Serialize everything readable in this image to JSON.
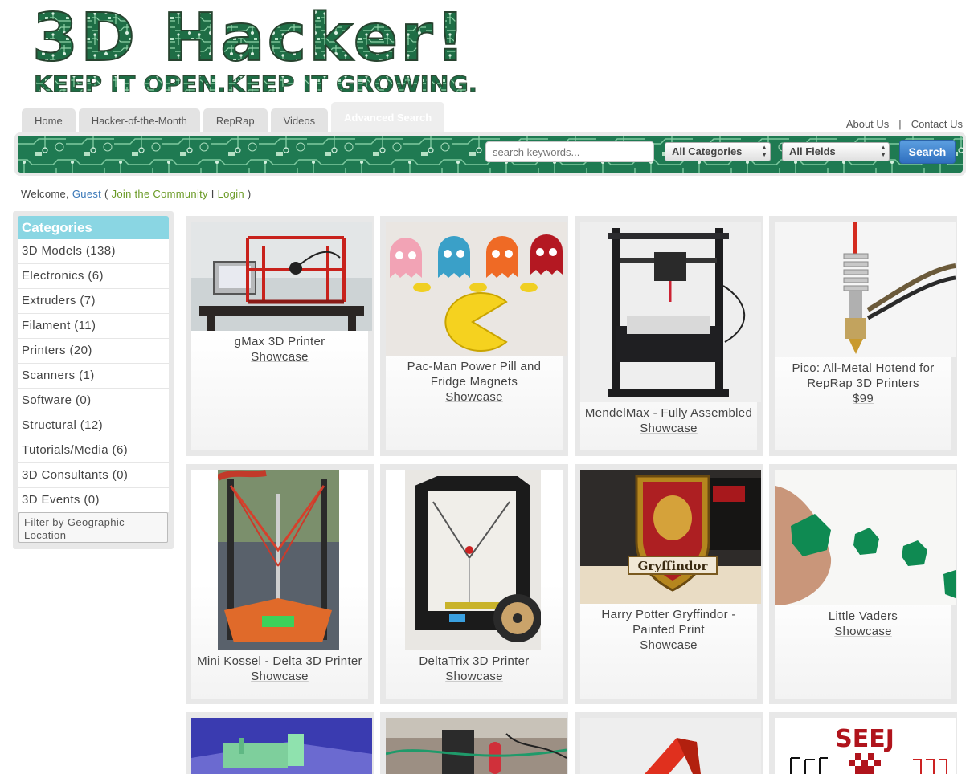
{
  "logo": {
    "title": "3D Hacker!",
    "tagline": "KEEP IT OPEN.KEEP IT GROWING."
  },
  "nav": {
    "tabs": [
      "Home",
      "Hacker-of-the-Month",
      "RepRap",
      "Videos",
      "Advanced Search"
    ],
    "active_tab": "Advanced Search",
    "about": "About Us",
    "separator": "|",
    "contact": "Contact Us"
  },
  "search": {
    "placeholder": "search keywords...",
    "category": "All Categories",
    "field": "All Fields",
    "button": "Search"
  },
  "welcome": {
    "prefix": "Welcome,",
    "user": "Guest",
    "open": "(",
    "join": "Join the Community",
    "sep": "I",
    "login": "Login",
    "close": ")"
  },
  "sidebar": {
    "title": "Categories",
    "items": [
      "3D Models (138)",
      "Electronics (6)",
      "Extruders (7)",
      "Filament (11)",
      "Printers (20)",
      "Scanners (1)",
      "Software (0)",
      "Structural (12)",
      "Tutorials/Media (6)",
      "3D Consultants (0)",
      "3D Events (0)"
    ],
    "geo_filter": "Filter by Geographic Location"
  },
  "listings": [
    {
      "title": "gMax 3D Printer",
      "sub": "Showcase"
    },
    {
      "title": "Pac-Man Power Pill and Fridge Magnets",
      "sub": "Showcase"
    },
    {
      "title": "MendelMax - Fully Assembled",
      "sub": "Showcase"
    },
    {
      "title": "Pico: All-Metal Hotend for RepRap 3D Printers",
      "sub": "$99"
    },
    {
      "title": "Mini Kossel - Delta 3D Printer",
      "sub": "Showcase"
    },
    {
      "title": "DeltaTrix 3D Printer",
      "sub": "Showcase"
    },
    {
      "title": "Harry Potter Gryffindor - Painted Print",
      "sub": "Showcase"
    },
    {
      "title": "Little Vaders",
      "sub": "Showcase"
    },
    {
      "title": "",
      "sub": ""
    },
    {
      "title": "",
      "sub": ""
    },
    {
      "title": "",
      "sub": ""
    },
    {
      "title": "",
      "sub": ""
    }
  ],
  "images": {
    "seej": "SEEJ",
    "gryffindor": "Gryffindor"
  },
  "colors": {
    "pcb_green": "#1f7a52",
    "category_header": "#8ad6e3",
    "link_blue": "#3a78b8",
    "link_green": "#6a9a25",
    "search_button": "#3b7ccc"
  }
}
